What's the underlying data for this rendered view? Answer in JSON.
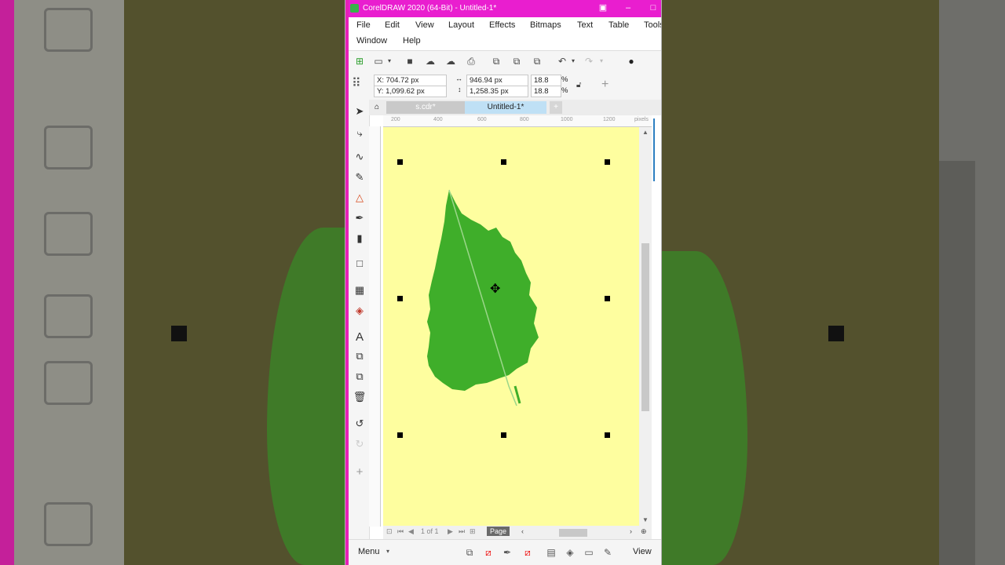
{
  "window": {
    "title": "CorelDRAW 2020 (64-Bit) - Untitled-1*"
  },
  "menu": [
    "File",
    "Edit",
    "View",
    "Layout",
    "Effects",
    "Bitmaps",
    "Text",
    "Table",
    "Tools",
    "Window",
    "Help"
  ],
  "props": {
    "x": "X: 704.72 px",
    "y": "Y: 1,099.62 px",
    "w": "946.94 px",
    "h": "1,258.35 px",
    "sx": "18.8",
    "sy": "18.8",
    "pct1": "%",
    "pct2": "%"
  },
  "tabs": [
    "s.cdr*",
    "Untitled-1*"
  ],
  "ruler": {
    "ticks": [
      "200",
      "400",
      "600",
      "800",
      "1000",
      "1200"
    ],
    "unit": "pixels"
  },
  "page_nav": {
    "text": "1 of 1",
    "page_label": "Page"
  },
  "bottom": {
    "menu_label": "Menu",
    "view_label": "View"
  },
  "colors": {
    "title_bar": "#e91ecf",
    "page": "#fefe9f",
    "leaf": "#3fae2a"
  }
}
